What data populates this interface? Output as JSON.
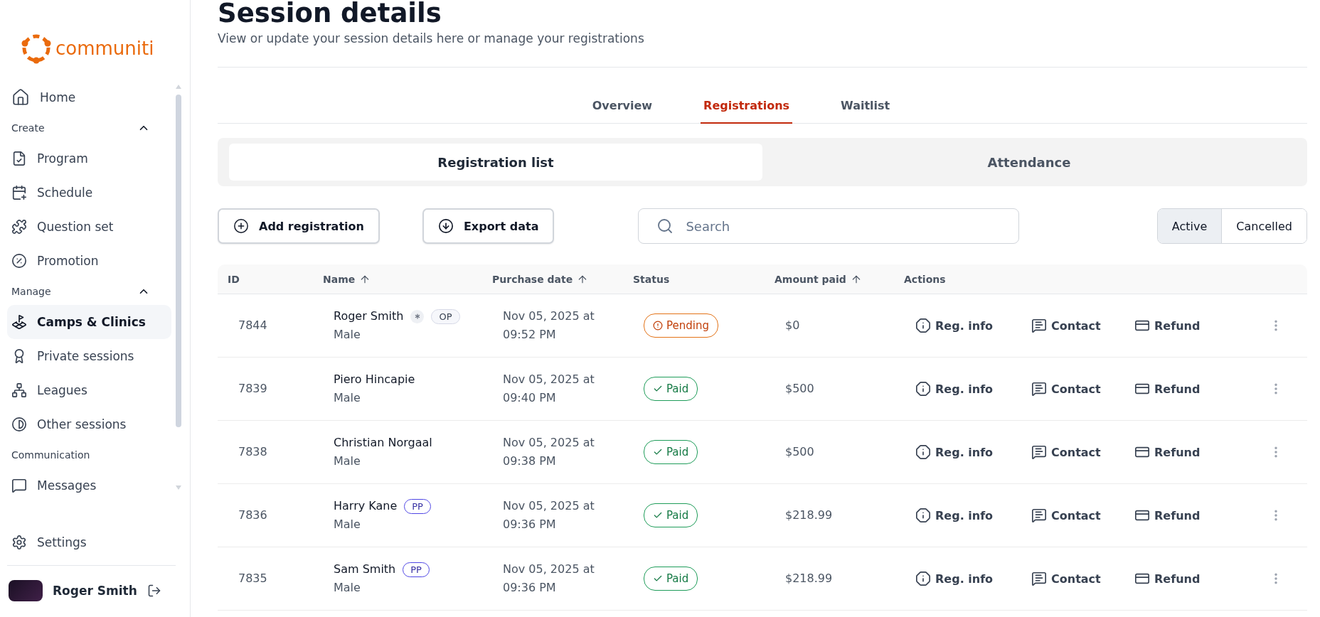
{
  "brand": {
    "name": "communiti"
  },
  "sidebar": {
    "home": {
      "label": "Home",
      "selected": false
    },
    "sections": [
      {
        "title": "Create",
        "expanded": true,
        "items": [
          {
            "label": "Program",
            "selected": false
          },
          {
            "label": "Schedule",
            "selected": false
          },
          {
            "label": "Question set",
            "selected": false
          },
          {
            "label": "Promotion",
            "selected": false
          }
        ]
      },
      {
        "title": "Manage",
        "expanded": true,
        "items": [
          {
            "label": "Camps & Clinics",
            "selected": true
          },
          {
            "label": "Private sessions",
            "selected": false
          },
          {
            "label": "Leagues",
            "selected": false
          },
          {
            "label": "Other sessions",
            "selected": false
          }
        ]
      },
      {
        "title": "Communication",
        "items": [
          {
            "label": "Messages",
            "selected": false
          }
        ]
      }
    ],
    "settings": "Settings",
    "user": {
      "name": "Roger Smith"
    }
  },
  "page": {
    "title": "Session details",
    "subtitle": "View or update your session details here or manage your registrations"
  },
  "tabs": [
    {
      "label": "Overview",
      "selected": false
    },
    {
      "label": "Registrations",
      "selected": true
    },
    {
      "label": "Waitlist",
      "selected": false
    }
  ],
  "views": [
    {
      "label": "Registration list",
      "selected": true
    },
    {
      "label": "Attendance",
      "selected": false
    }
  ],
  "toolbar": {
    "add": "Add registration",
    "export": "Export data",
    "search": {
      "placeholder": "Search"
    },
    "filters": [
      {
        "label": "Active",
        "selected": true
      },
      {
        "label": "Cancelled",
        "selected": false
      }
    ]
  },
  "table": {
    "columns": [
      {
        "label": "ID",
        "sortable": false
      },
      {
        "label": "Name",
        "sortable": true
      },
      {
        "label": "Purchase date",
        "sortable": true
      },
      {
        "label": "Status",
        "sortable": false
      },
      {
        "label": "Amount paid",
        "sortable": true
      },
      {
        "label": "Actions",
        "sortable": false
      }
    ],
    "rows": [
      {
        "id": "7844",
        "name": "Roger Smith",
        "gender": "Male",
        "marked": true,
        "tags": [
          {
            "label": "OP",
            "kind": "neutral"
          }
        ],
        "date": "Nov 05, 2025 at 09:52 PM",
        "status": {
          "label": "Pending",
          "kind": "pending"
        },
        "amount": "$0",
        "actions": [
          "Reg. info",
          "Contact",
          "Refund"
        ]
      },
      {
        "id": "7839",
        "name": "Piero Hincapie",
        "gender": "Male",
        "marked": false,
        "tags": [],
        "date": "Nov 05, 2025 at 09:40 PM",
        "status": {
          "label": "Paid",
          "kind": "paid"
        },
        "amount": "$500",
        "actions": [
          "Reg. info",
          "Contact",
          "Refund"
        ]
      },
      {
        "id": "7838",
        "name": "Christian Norgaal",
        "gender": "Male",
        "marked": false,
        "tags": [],
        "date": "Nov 05, 2025 at 09:38 PM",
        "status": {
          "label": "Paid",
          "kind": "paid"
        },
        "amount": "$500",
        "actions": [
          "Reg. info",
          "Contact",
          "Refund"
        ]
      },
      {
        "id": "7836",
        "name": "Harry Kane",
        "gender": "Male",
        "marked": false,
        "tags": [
          {
            "label": "PP",
            "kind": "accent"
          }
        ],
        "date": "Nov 05, 2025 at 09:36 PM",
        "status": {
          "label": "Paid",
          "kind": "paid"
        },
        "amount": "$218.99",
        "actions": [
          "Reg. info",
          "Contact",
          "Refund"
        ]
      },
      {
        "id": "7835",
        "name": "Sam Smith",
        "gender": "Male",
        "marked": false,
        "tags": [
          {
            "label": "PP",
            "kind": "accent"
          }
        ],
        "date": "Nov 05, 2025 at 09:36 PM",
        "status": {
          "label": "Paid",
          "kind": "paid"
        },
        "amount": "$218.99",
        "actions": [
          "Reg. info",
          "Contact",
          "Refund"
        ]
      }
    ]
  }
}
